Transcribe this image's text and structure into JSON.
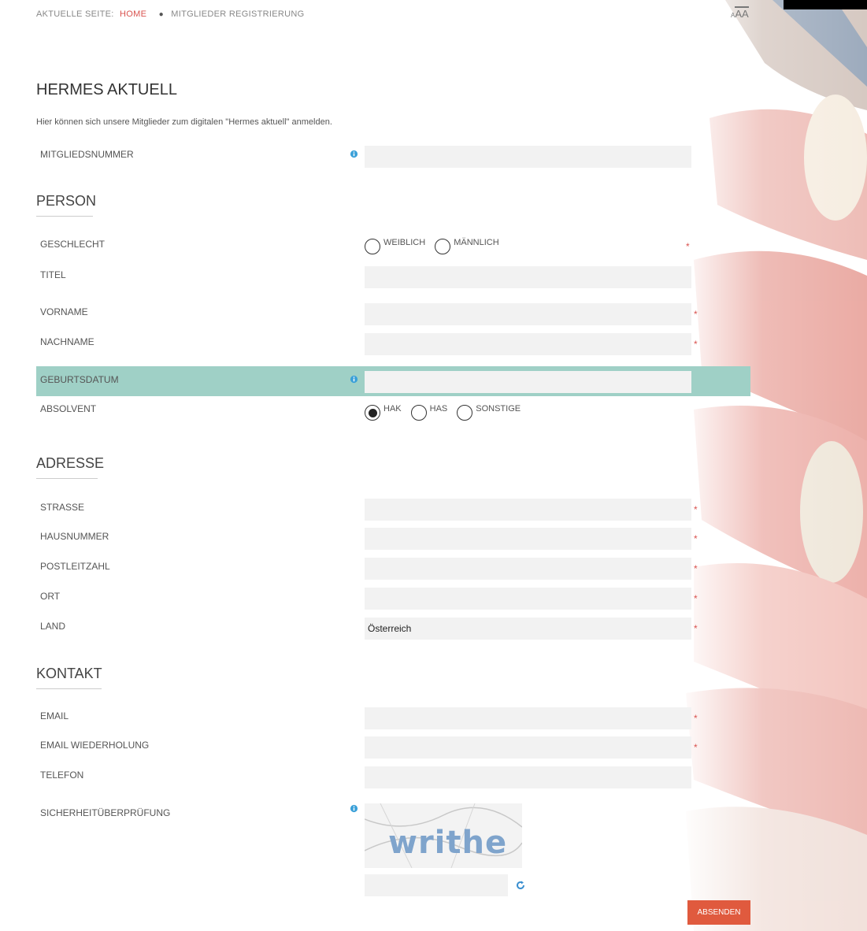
{
  "breadcrumb": {
    "prefix": "AKTUELLE SEITE:",
    "home": "HOME",
    "current": "MITGLIEDER REGISTRIERUNG"
  },
  "font_size_control": {
    "small": "A",
    "medium": "A",
    "large": "A"
  },
  "page_title": "HERMES AKTUELL",
  "intro": "Hier können sich unsere Mitglieder zum digitalen \"Hermes aktuell\" anmelden.",
  "fields": {
    "member_number": "MITGLIEDSNUMMER",
    "gender": "GESCHLECHT",
    "title": "TITEL",
    "first_name": "VORNAME",
    "last_name": "NACHNAME",
    "birth_date": "GEBURTSDATUM",
    "graduate": "ABSOLVENT",
    "street": "STRASSE",
    "house_number": "HAUSNUMMER",
    "zip": "POSTLEITZAHL",
    "city": "ORT",
    "country": "LAND",
    "email": "EMAIL",
    "email_repeat": "EMAIL WIEDERHOLUNG",
    "phone": "TELEFON",
    "security": "SICHERHEITÜBERPRÜFUNG"
  },
  "sections": {
    "person": "PERSON",
    "address": "ADRESSE",
    "contact": "KONTAKT"
  },
  "gender_options": [
    "WEIBLICH",
    "MÄNNLICH"
  ],
  "graduate_options": [
    "HAK",
    "HAS",
    "SONSTIGE"
  ],
  "graduate_selected": "HAK",
  "country_value": "Österreich",
  "required_mark": "*",
  "captcha_text": "writhe",
  "submit_label": "ABSENDEN",
  "colors": {
    "accent": "#e05a3e",
    "highlight": "#9fd0c6",
    "field": "#f2f2f2",
    "home_link": "#d9534f"
  }
}
